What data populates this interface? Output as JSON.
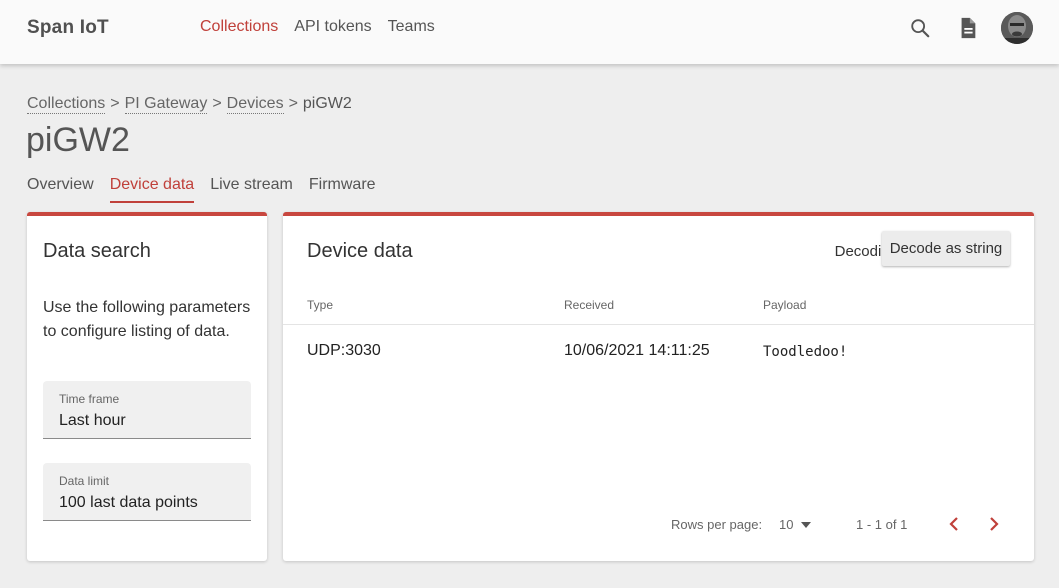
{
  "app": {
    "brand": "Span IoT"
  },
  "nav": {
    "items": [
      "Collections",
      "API tokens",
      "Teams"
    ],
    "active": "Collections"
  },
  "breadcrumb": {
    "items": [
      "Collections",
      "PI Gateway",
      "Devices"
    ],
    "current": "piGW2",
    "separator": ">"
  },
  "page": {
    "title": "piGW2"
  },
  "tabs": {
    "items": [
      "Overview",
      "Device data",
      "Live stream",
      "Firmware"
    ],
    "active": "Device data"
  },
  "search": {
    "title": "Data search",
    "description": "Use the following parameters to configure listing of data.",
    "time_frame": {
      "label": "Time frame",
      "value": "Last hour"
    },
    "data_limit": {
      "label": "Data limit",
      "value": "100 last data points"
    }
  },
  "device_data": {
    "title": "Device data",
    "decoding_label": "Decoding",
    "decode_button": "Decode as string",
    "columns": [
      "Type",
      "Received",
      "Payload"
    ],
    "rows": [
      {
        "type": "UDP:3030",
        "received": "10/06/2021 14:11:25",
        "payload": "Toodledoo!"
      }
    ],
    "pagination": {
      "rows_per_page_label": "Rows per page:",
      "rows_per_page": "10",
      "range": "1 - 1 of 1"
    }
  },
  "colors": {
    "accent": "#c0403a",
    "card_border": "#c8473f",
    "background": "#eeeeee"
  },
  "icons": {
    "search": "search-icon",
    "docs": "document-icon",
    "dropdown": "caret-down-icon",
    "prev": "chevron-left-icon",
    "next": "chevron-right-icon"
  }
}
